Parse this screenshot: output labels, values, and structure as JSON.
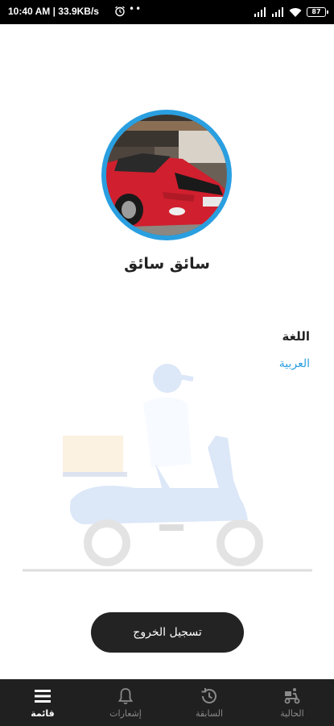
{
  "status_bar": {
    "time": "10:40 AM | 33.9KB/s",
    "dots": "••",
    "battery": "87"
  },
  "profile": {
    "name": "سائق سائق"
  },
  "language": {
    "title": "اللغة",
    "value": "العربية"
  },
  "logout_label": "تسجيل الخروج",
  "bottom_nav": {
    "menu": "قائمة",
    "notifications": "إشعارات",
    "previous": "السابقة",
    "current": "الحالية"
  },
  "colors": {
    "accent": "#2a9fe0",
    "nav_background": "#202020",
    "logout_background": "#232323"
  }
}
